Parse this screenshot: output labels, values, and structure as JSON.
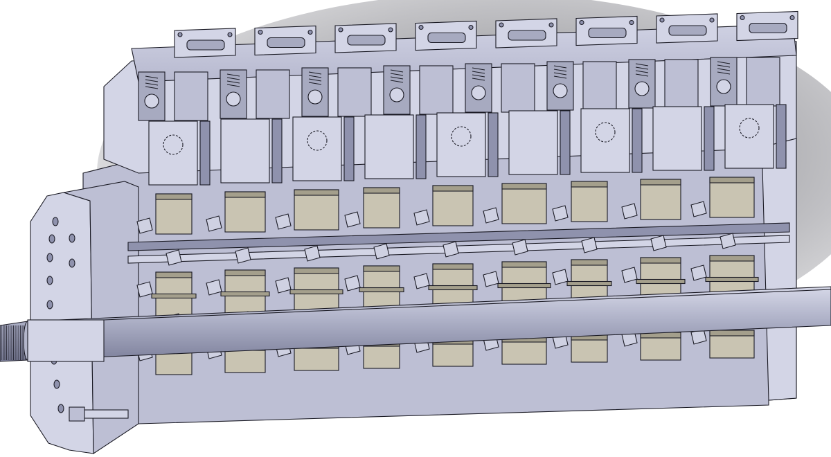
{
  "scene": {
    "subject": "cad-gearbox-cross-section",
    "palette": {
      "background_light": "#ffffff",
      "background_shadow": "#9a9a9e",
      "housing": "#bdbfd4",
      "housing_light": "#d3d5e6",
      "housing_dark": "#8f92ad",
      "void": "#a7aac0",
      "gear": "#c9c4b2",
      "gear_dark": "#a49f8c",
      "bearing": "#cfd1e2",
      "shaft": "#b3b6cb",
      "edge": "#1a1a24"
    },
    "counts": {
      "top_ports": 8,
      "gear_columns": 9,
      "bearing_rows": 5
    }
  }
}
